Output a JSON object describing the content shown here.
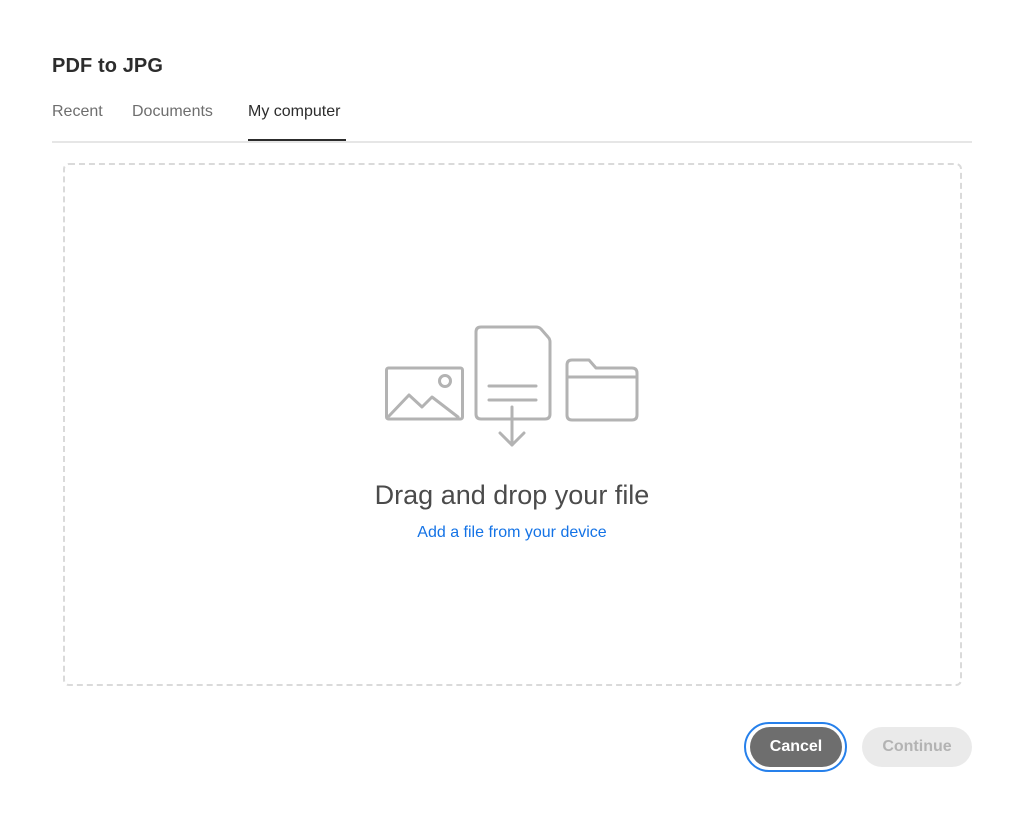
{
  "dialog": {
    "title": "PDF to JPG"
  },
  "tabs": [
    {
      "label": "Recent",
      "selected": false
    },
    {
      "label": "Documents",
      "selected": false
    },
    {
      "label": "My computer",
      "selected": true
    }
  ],
  "dropzone": {
    "heading": "Drag and drop your file",
    "link_label": "Add a file from your device",
    "icons": [
      "image-icon",
      "document-download-icon",
      "folder-icon"
    ]
  },
  "buttons": {
    "cancel_label": "Cancel",
    "continue_label": "Continue",
    "continue_enabled": false
  },
  "colors": {
    "accent_link": "#1473e6",
    "focus_ring": "#2680eb",
    "cancel_bg": "#6e6e6e",
    "continue_disabled_bg": "#eaeaea",
    "icon_gray": "#b3b3b3"
  }
}
